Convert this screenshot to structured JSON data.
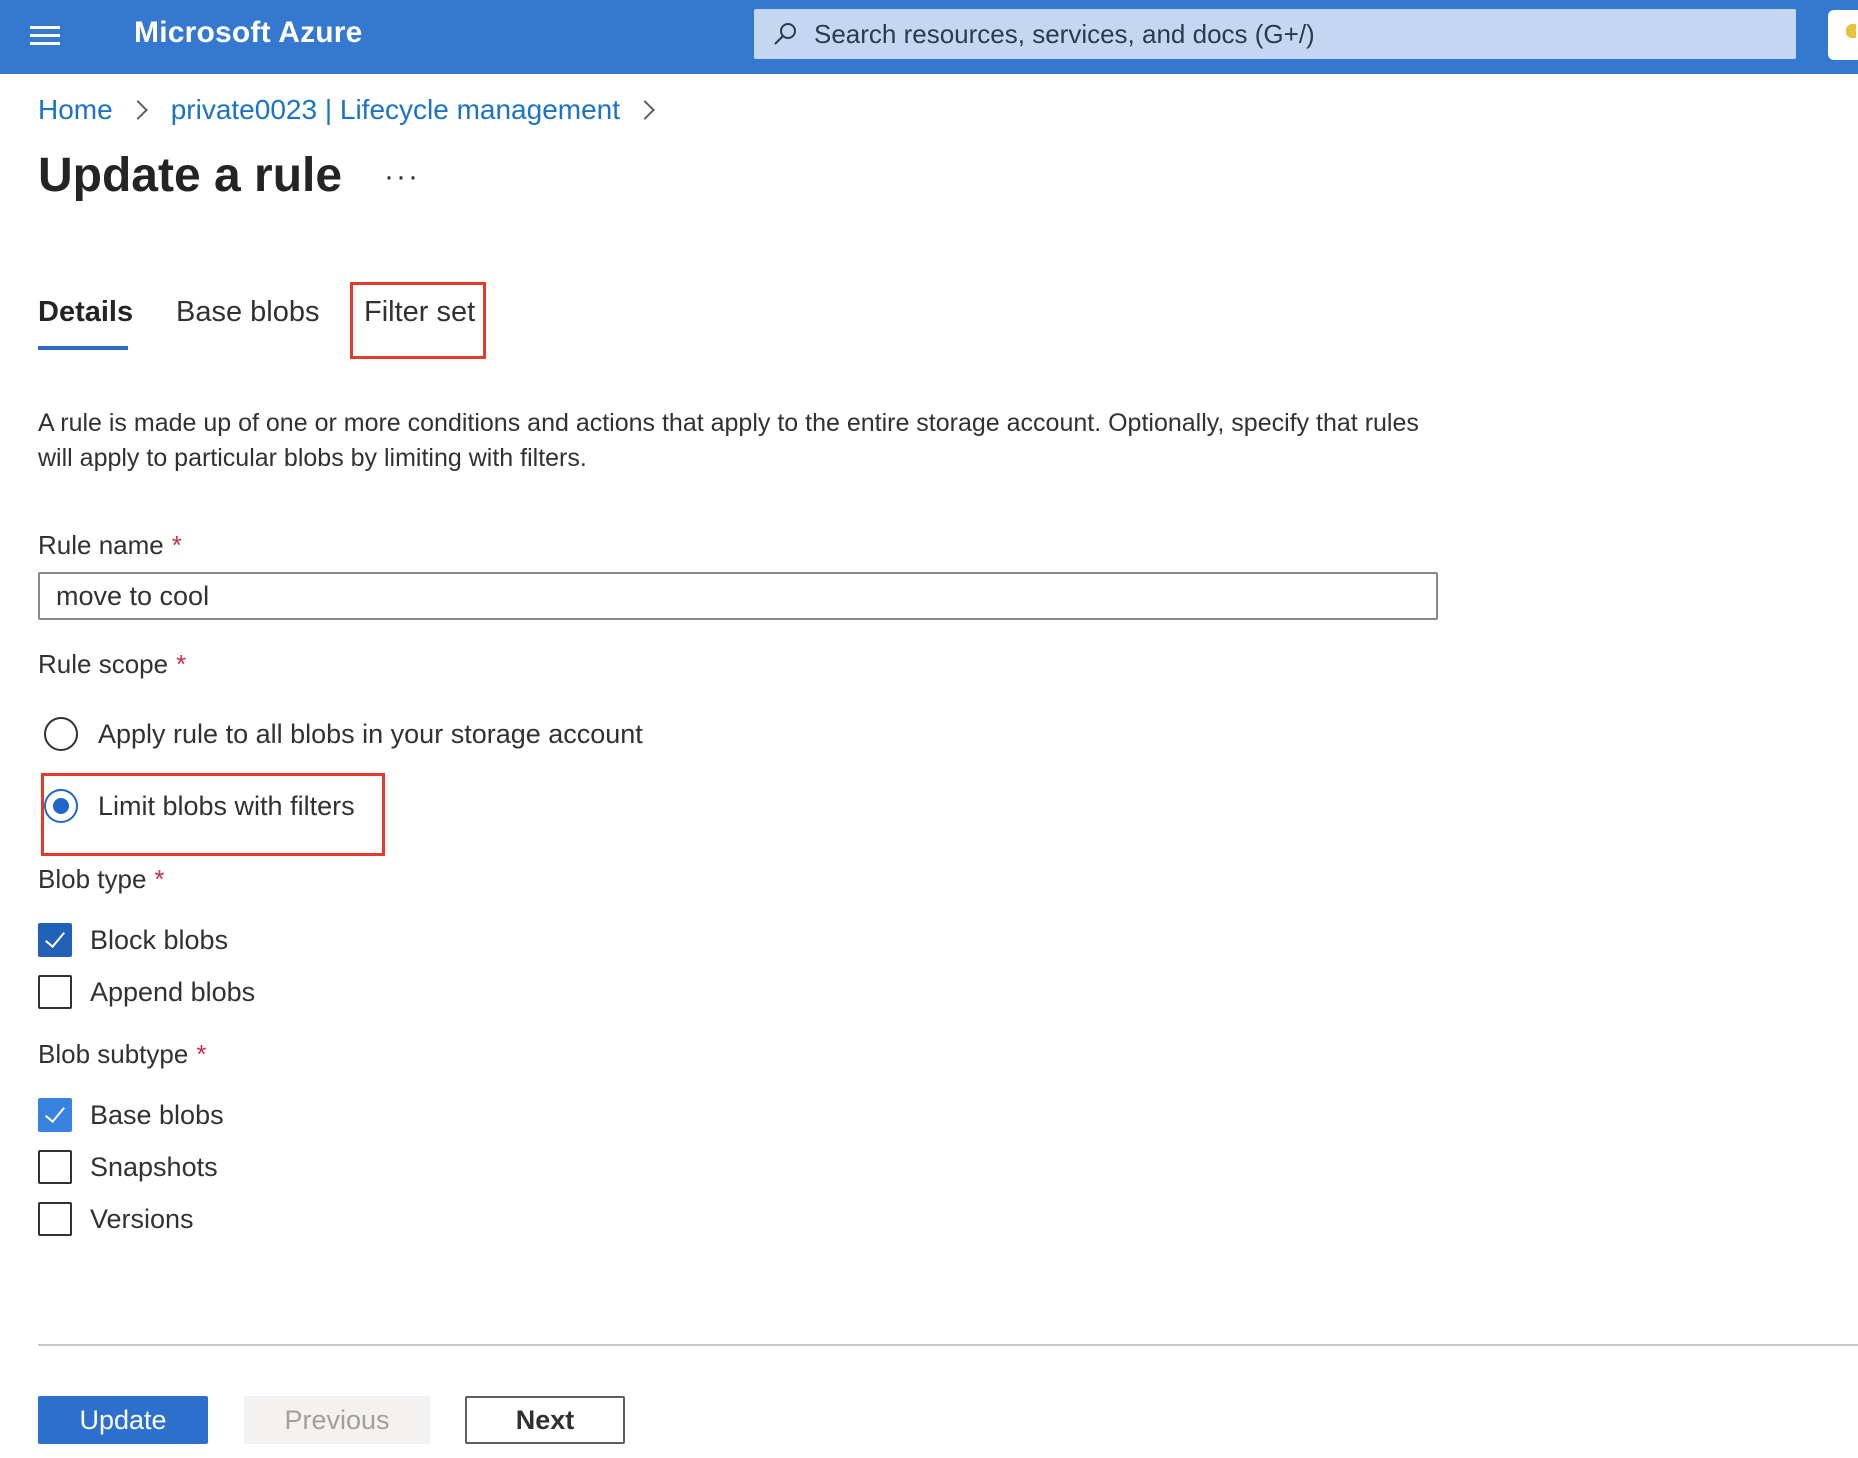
{
  "header": {
    "brand": "Microsoft Azure",
    "search_placeholder": "Search resources, services, and docs (G+/)"
  },
  "breadcrumb": {
    "items": [
      "Home",
      "private0023 | Lifecycle management"
    ]
  },
  "page": {
    "title": "Update a rule",
    "more_label": "···"
  },
  "tabs": [
    {
      "label": "Details",
      "active": true
    },
    {
      "label": "Base blobs",
      "active": false
    },
    {
      "label": "Filter set",
      "active": false
    }
  ],
  "description": "A rule is made up of one or more conditions and actions that apply to the entire storage account. Optionally, specify that rules will apply to particular blobs by limiting with filters.",
  "form": {
    "required_mark": "*",
    "rule_name": {
      "label": "Rule name",
      "value": "move to cool"
    },
    "rule_scope": {
      "label": "Rule scope",
      "options": [
        {
          "label": "Apply rule to all blobs in your storage account",
          "selected": false
        },
        {
          "label": "Limit blobs with filters",
          "selected": true
        }
      ]
    },
    "blob_type": {
      "label": "Blob type",
      "options": [
        {
          "label": "Block blobs",
          "checked": true
        },
        {
          "label": "Append blobs",
          "checked": false
        }
      ]
    },
    "blob_subtype": {
      "label": "Blob subtype",
      "options": [
        {
          "label": "Base blobs",
          "checked": true
        },
        {
          "label": "Snapshots",
          "checked": false
        },
        {
          "label": "Versions",
          "checked": false
        }
      ]
    }
  },
  "footer": {
    "update_label": "Update",
    "previous_label": "Previous",
    "next_label": "Next"
  },
  "colors": {
    "header_bg": "#3578d0",
    "link": "#1a73c6",
    "highlight_box": "#e23b2b",
    "primary_button": "#2d6fcd"
  }
}
